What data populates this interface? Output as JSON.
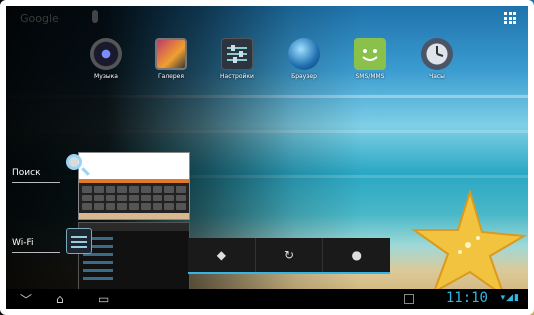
{
  "topbar": {
    "google_search": "Google"
  },
  "apps": [
    {
      "label": "Музыка",
      "icon": "music-icon"
    },
    {
      "label": "Галерея",
      "icon": "gallery-icon"
    },
    {
      "label": "Настройки",
      "icon": "settings-icon"
    },
    {
      "label": "Браузер",
      "icon": "browser-icon"
    },
    {
      "label": "SMS/MMS",
      "icon": "sms-icon"
    },
    {
      "label": "Часы",
      "icon": "clock-icon"
    }
  ],
  "recent_apps": [
    {
      "label": "Поиск",
      "icon": "search-icon"
    },
    {
      "label": "Wi-Fi",
      "icon": "settings-icon"
    }
  ],
  "quick_bar": [
    {
      "glyph": "◆",
      "icon": "location-icon"
    },
    {
      "glyph": "↻",
      "icon": "sync-icon"
    },
    {
      "glyph": "●",
      "icon": "brightness-icon"
    }
  ],
  "statusbar": {
    "time": "11:10",
    "icons": "▾◢▮"
  },
  "colors": {
    "accent": "#33b5e5"
  }
}
